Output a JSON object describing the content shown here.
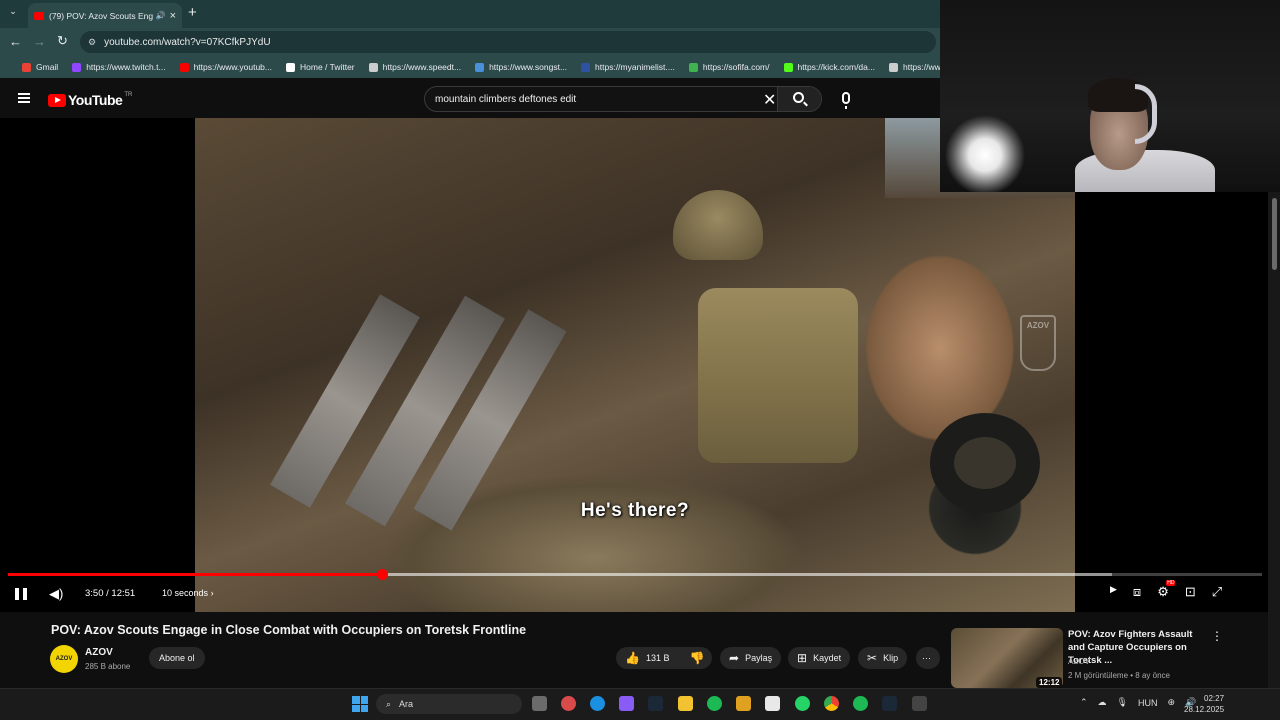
{
  "browser": {
    "tab_title": "(79) POV: Azov Scouts Engage",
    "url": "youtube.com/watch?v=07KCfkPJYdU",
    "bookmarks": [
      {
        "label": "Gmail",
        "color": "#ea4335"
      },
      {
        "label": "https://www.twitch.t...",
        "color": "#9146ff"
      },
      {
        "label": "https://www.youtub...",
        "color": "#ff0000"
      },
      {
        "label": "Home / Twitter",
        "color": "#ffffff"
      },
      {
        "label": "https://www.speedt...",
        "color": "#cccccc"
      },
      {
        "label": "https://www.songst...",
        "color": "#4a8fd9"
      },
      {
        "label": "https://myanimelist....",
        "color": "#2e51a2"
      },
      {
        "label": "https://sofifa.com/",
        "color": "#3fb34f"
      },
      {
        "label": "https://kick.com/da...",
        "color": "#53fc18"
      },
      {
        "label": "https://www.ma",
        "color": "#cccccc"
      }
    ]
  },
  "youtube": {
    "logo_text": "YouTube",
    "logo_region": "TR",
    "search_value": "mountain climbers deftones edit"
  },
  "player": {
    "subtitle": "He's there?",
    "watermark": "AZOV",
    "time": "3:50 / 12:51",
    "chapter": "10 seconds",
    "progress_fraction": 0.298,
    "buffer_fraction": 0.88,
    "accent_color": "#ff0000"
  },
  "video": {
    "title": "POV: Azov Scouts Engage in Close Combat with Occupiers on Toretsk Frontline",
    "channel": "AZOV",
    "channel_avatar_text": "AZOV",
    "subscribers": "285 B abone",
    "subscribe_label": "Abone ol",
    "likes": "131 B",
    "share_label": "Paylaş",
    "save_label": "Kaydet",
    "clip_label": "Klip"
  },
  "recommendation": {
    "title": "POV: Azov Fighters Assault and Capture Occupiers on Toretsk ...",
    "channel": "AZOV",
    "meta": "2 M görüntüleme • 8 ay önce",
    "duration": "12:12"
  },
  "taskbar": {
    "search_label": "Ara",
    "language": "HUN",
    "time": "02:27",
    "date": "28.12.2025"
  }
}
